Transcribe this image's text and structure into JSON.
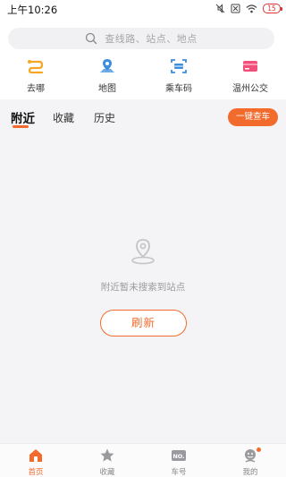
{
  "status_bar": {
    "time": "上午10:26",
    "battery": "15"
  },
  "search": {
    "placeholder": "查线路、站点、地点"
  },
  "shortcuts": [
    {
      "label": "去哪",
      "icon": "route-icon",
      "color": "#f5a623"
    },
    {
      "label": "地图",
      "icon": "map-pin-icon",
      "color": "#3c8dde"
    },
    {
      "label": "乘车码",
      "icon": "scan-code-icon",
      "color": "#3c8dde"
    },
    {
      "label": "温州公交",
      "icon": "card-icon",
      "color": "#f0507a"
    }
  ],
  "tabs": [
    {
      "label": "附近",
      "active": true
    },
    {
      "label": "收藏",
      "active": false
    },
    {
      "label": "历史",
      "active": false
    }
  ],
  "quick_button": "一键查车",
  "empty_state": {
    "message": "附近暂未搜索到站点",
    "refresh": "刷新"
  },
  "bottom_nav": [
    {
      "label": "首页",
      "icon": "home-icon",
      "active": true
    },
    {
      "label": "收藏",
      "icon": "star-icon",
      "active": false
    },
    {
      "label": "车号",
      "icon": "bus-number-icon",
      "active": false
    },
    {
      "label": "我的",
      "icon": "profile-icon",
      "active": false,
      "badge": true
    }
  ],
  "colors": {
    "accent": "#f26b2d",
    "background": "#f4f4f6"
  }
}
